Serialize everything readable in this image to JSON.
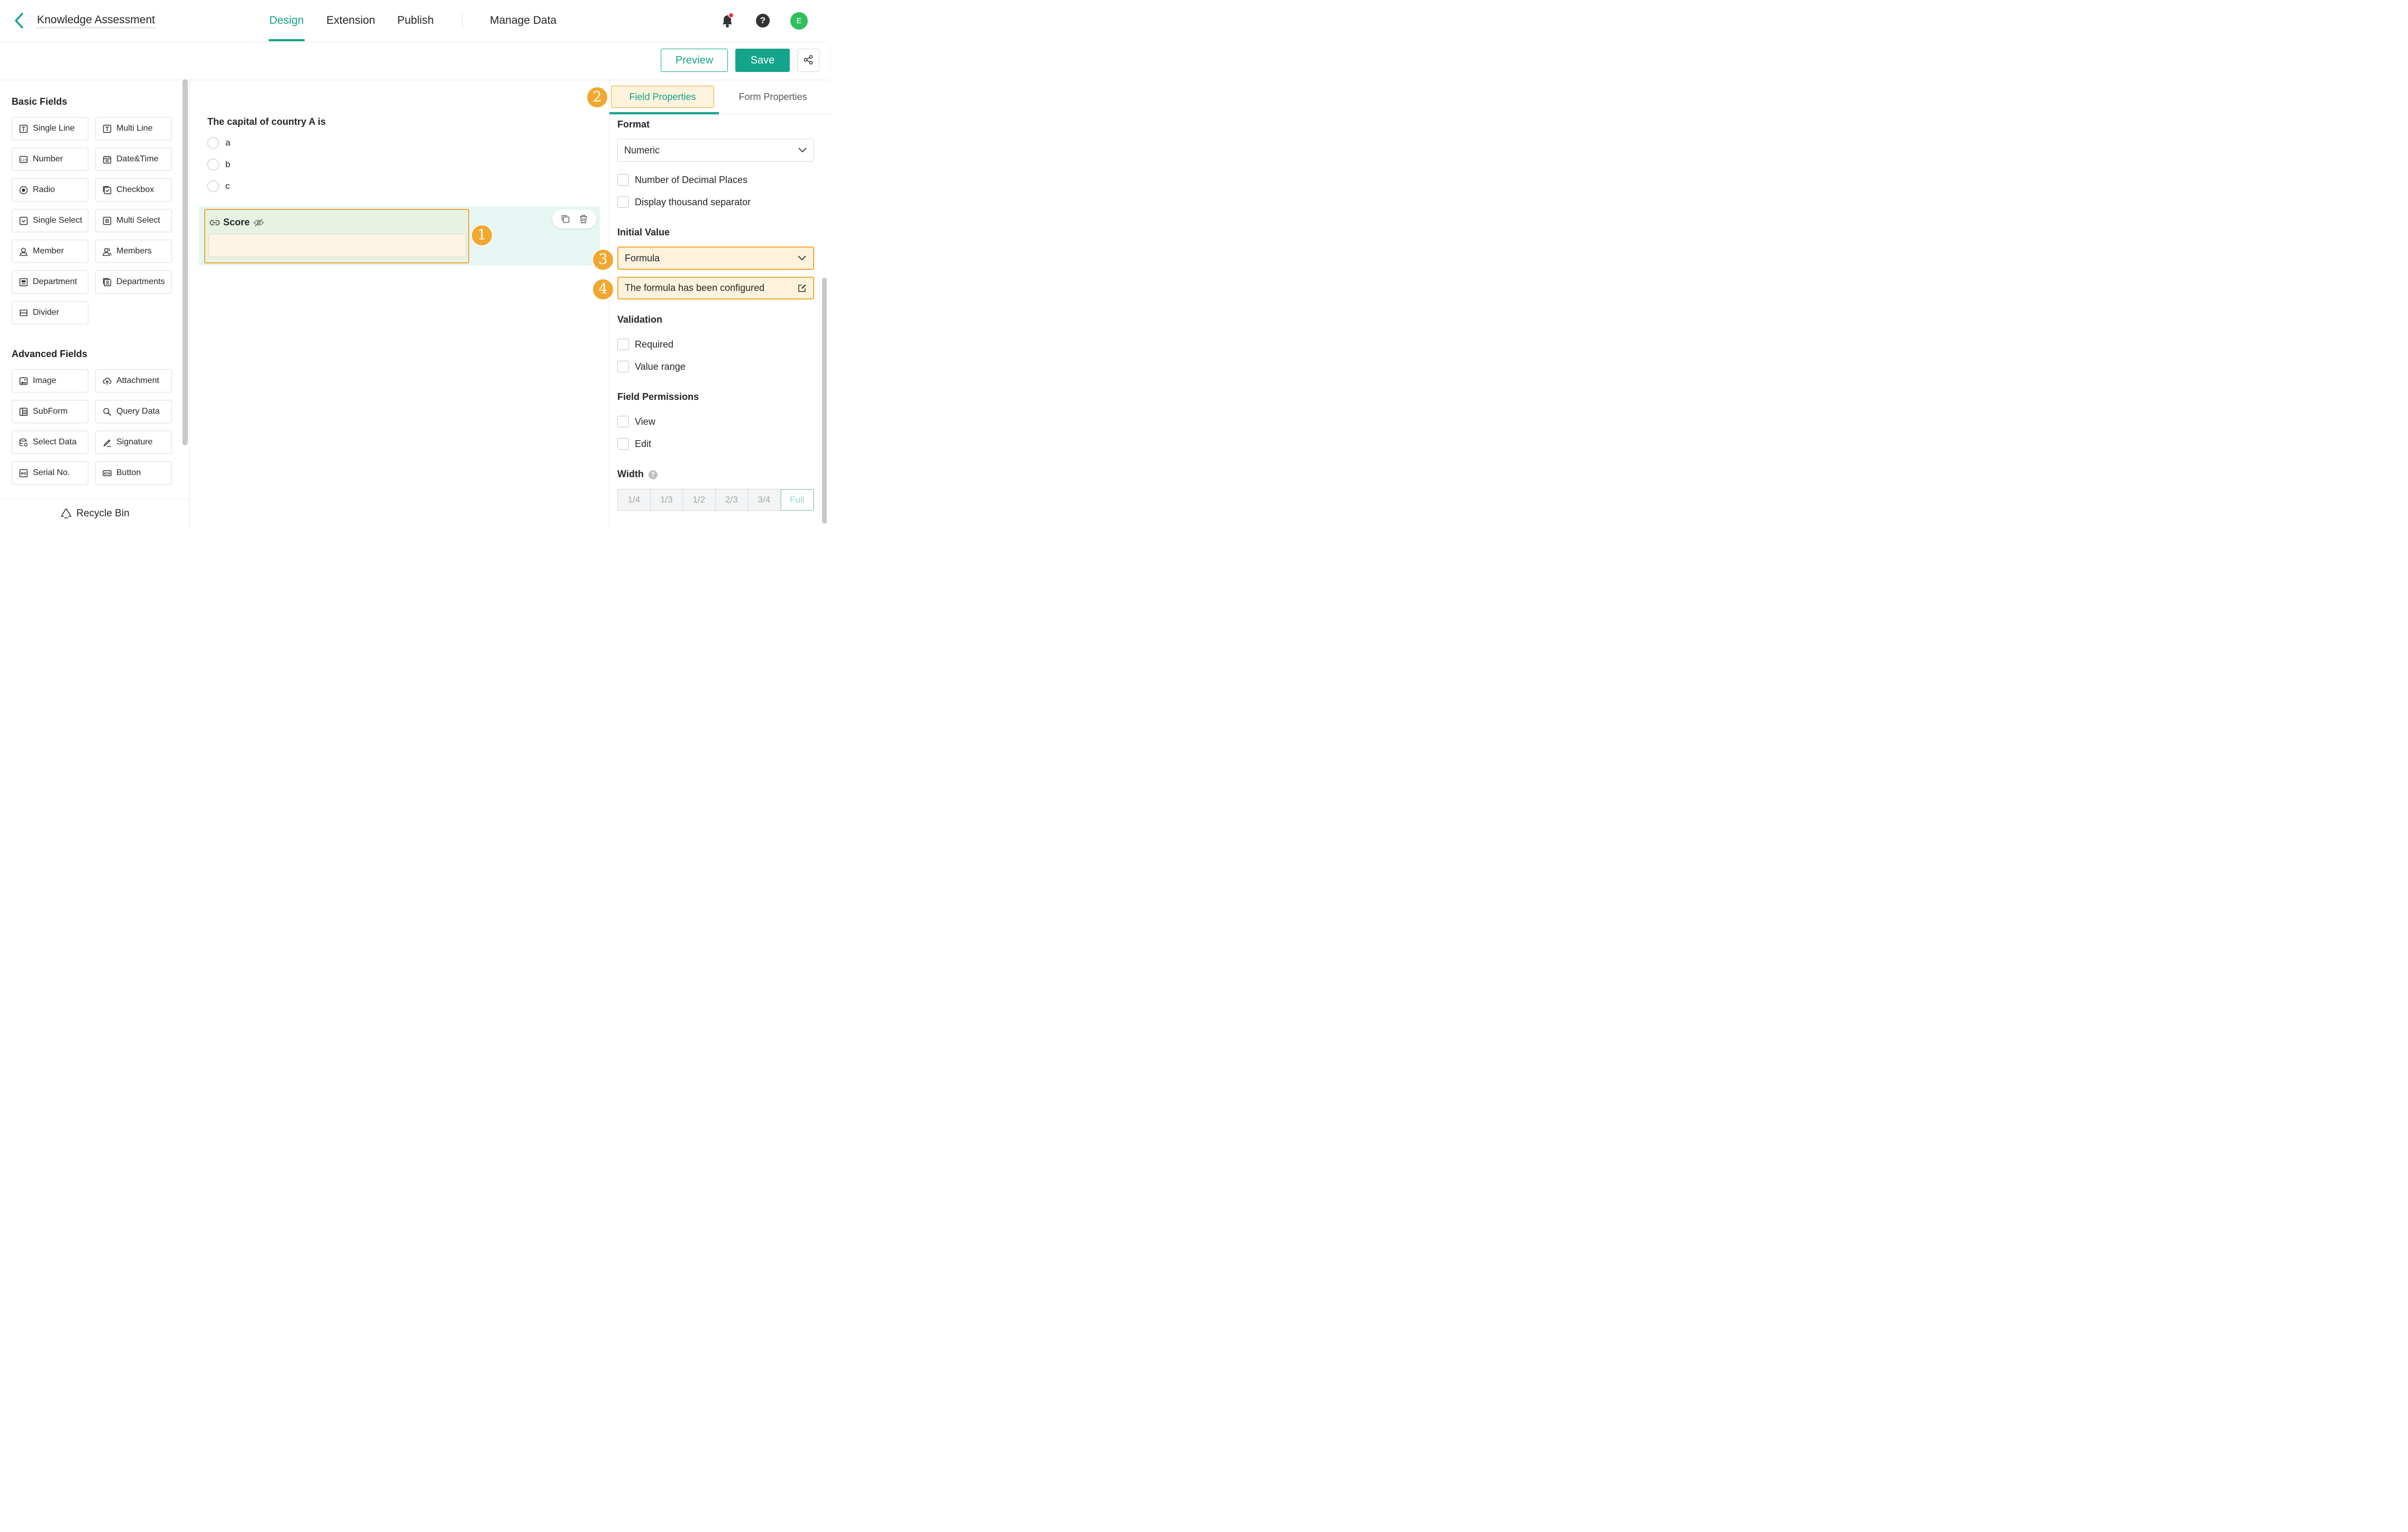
{
  "header": {
    "app_title": "Knowledge Assessment",
    "tabs": [
      {
        "label": "Design",
        "active": true
      },
      {
        "label": "Extension",
        "active": false
      },
      {
        "label": "Publish",
        "active": false
      },
      {
        "label": "Manage Data",
        "active": false
      }
    ],
    "avatar_initial": "E",
    "help_label": "?",
    "notification_dot_color": "#f5222d"
  },
  "toolbar": {
    "preview_label": "Preview",
    "save_label": "Save"
  },
  "left_panel": {
    "basic_title": "Basic Fields",
    "basic_fields": [
      {
        "label": "Single Line",
        "icon": "single-line-icon"
      },
      {
        "label": "Multi Line",
        "icon": "multi-line-icon"
      },
      {
        "label": "Number",
        "icon": "number-icon"
      },
      {
        "label": "Date&Time",
        "icon": "calendar-icon"
      },
      {
        "label": "Radio",
        "icon": "radio-icon"
      },
      {
        "label": "Checkbox",
        "icon": "checkbox-icon"
      },
      {
        "label": "Single Select",
        "icon": "single-select-icon"
      },
      {
        "label": "Multi Select",
        "icon": "multi-select-icon"
      },
      {
        "label": "Member",
        "icon": "member-icon"
      },
      {
        "label": "Members",
        "icon": "members-icon"
      },
      {
        "label": "Department",
        "icon": "department-icon"
      },
      {
        "label": "Departments",
        "icon": "departments-icon"
      },
      {
        "label": "Divider",
        "icon": "divider-icon"
      }
    ],
    "advanced_title": "Advanced Fields",
    "advanced_fields": [
      {
        "label": "Image",
        "icon": "image-icon"
      },
      {
        "label": "Attachment",
        "icon": "upload-icon"
      },
      {
        "label": "SubForm",
        "icon": "subform-icon"
      },
      {
        "label": "Query Data",
        "icon": "query-icon"
      },
      {
        "label": "Select Data",
        "icon": "select-data-icon"
      },
      {
        "label": "Signature",
        "icon": "pen-icon"
      },
      {
        "label": "Serial No.",
        "icon": "serial-icon"
      },
      {
        "label": "Button",
        "icon": "button-icon"
      }
    ],
    "recycle_label": "Recycle Bin"
  },
  "canvas": {
    "question_title": "The capital of country A is",
    "options": [
      "a",
      "b",
      "c"
    ],
    "score_field_label": "Score",
    "score_field_value": ""
  },
  "annotations": [
    "1",
    "2",
    "3",
    "4"
  ],
  "right_panel": {
    "tabs": [
      {
        "label": "Field Properties",
        "active": true
      },
      {
        "label": "Form Properties",
        "active": false
      }
    ],
    "format_title": "Format",
    "format_value": "Numeric",
    "format_checks": [
      "Number of Decimal Places",
      "Display thousand separator"
    ],
    "initial_value_title": "Initial Value",
    "initial_value_type": "Formula",
    "formula_status": "The formula has been configured",
    "validation_title": "Validation",
    "validation_checks": [
      "Required",
      "Value range"
    ],
    "permissions_title": "Field Permissions",
    "permission_checks": [
      "View",
      "Edit"
    ],
    "width_title": "Width",
    "width_options": [
      "1/4",
      "1/3",
      "1/2",
      "2/3",
      "3/4",
      "Full"
    ],
    "width_selected": "Full"
  },
  "colors": {
    "accent": "#14a38b",
    "highlight_border": "#f0a830",
    "highlight_fill": "#fdf3dd"
  }
}
